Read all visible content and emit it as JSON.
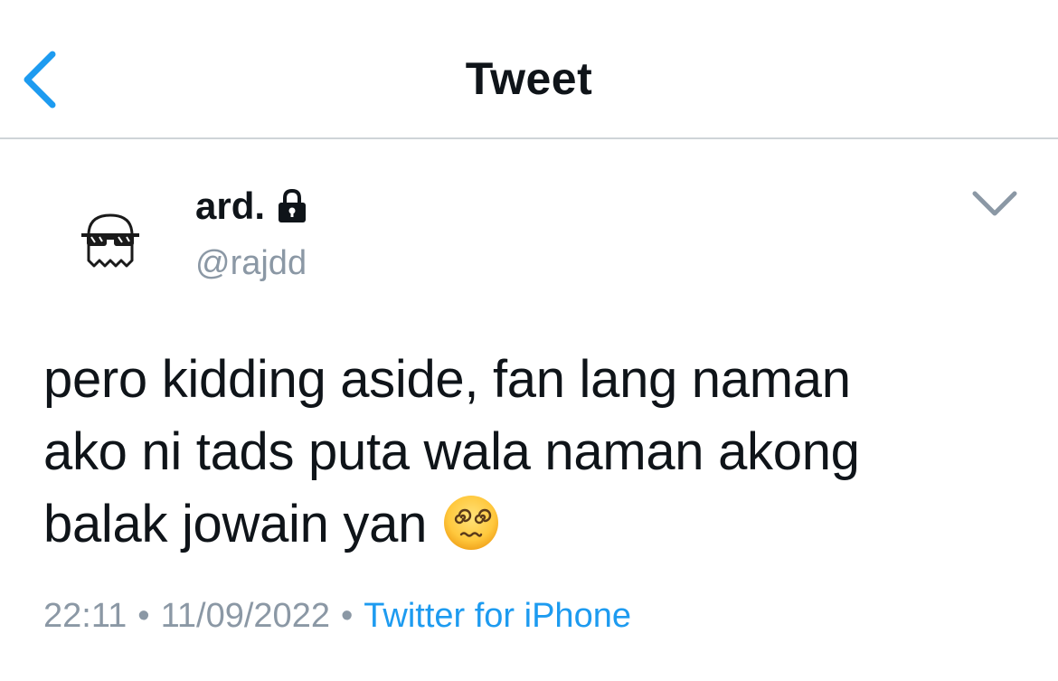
{
  "header": {
    "title": "Tweet",
    "back_icon": "chevron-left-icon",
    "accent": "#1d9bf0"
  },
  "tweet": {
    "display_name": "ard.",
    "protected_icon": "lock-icon",
    "handle": "@rajdd",
    "menu_icon": "chevron-down-icon",
    "avatar_icon": "ghost-with-sunglasses-avatar",
    "text_lines": [
      "pero kidding aside, fan lang naman",
      "ako ni tads puta wala naman akong",
      "balak jowain yan"
    ],
    "emoji_icon": "dizzy-face-emoji",
    "time": "22:11",
    "date": "11/09/2022",
    "separator": "•",
    "source": "Twitter for iPhone"
  },
  "colors": {
    "text": "#0f1419",
    "muted": "#8b98a5",
    "link": "#1d9bf0",
    "divider": "#cfd4d8"
  }
}
